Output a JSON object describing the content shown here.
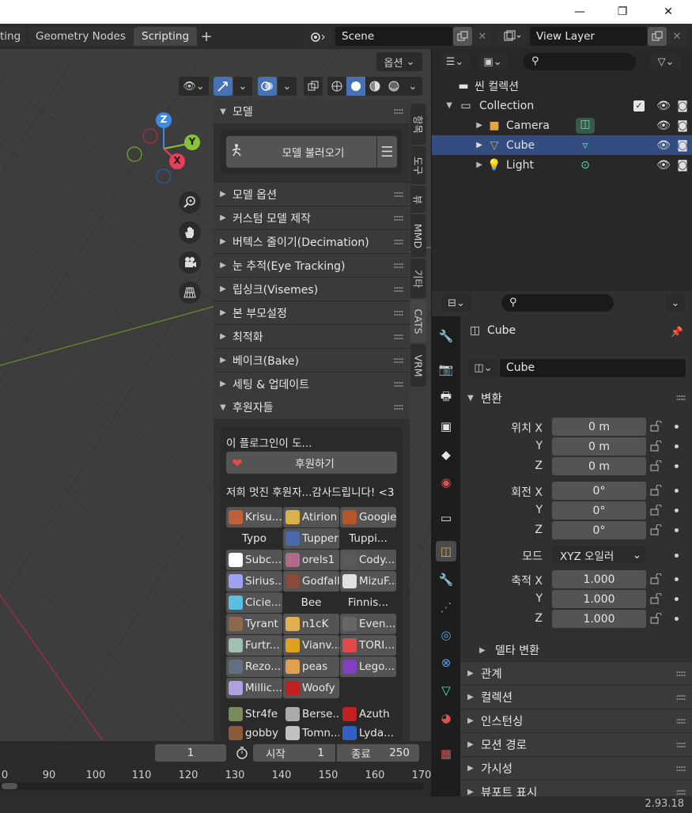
{
  "window": {
    "minimize": "—",
    "maximize": "❐",
    "close": "✕"
  },
  "workspace_tabs": [
    {
      "label": "ting",
      "active": false
    },
    {
      "label": "Geometry Nodes",
      "active": false
    },
    {
      "label": "Scripting",
      "active": true
    }
  ],
  "scene": {
    "label": "Scene",
    "view_layer": "View Layer"
  },
  "viewport": {
    "options_label": "옵션",
    "gizmo_axes": [
      "Z",
      "Y",
      "X"
    ]
  },
  "cats": {
    "model_header": "모델",
    "import_button": "모델 불러오기",
    "sections": [
      "모델 옵션",
      "커스텀 모델 제작",
      "버텍스 줄이기(Decimation)",
      "눈 추적(Eye Tracking)",
      "립싱크(Visemes)",
      "본 부모설정",
      "최적화",
      "베이크(Bake)",
      "세팅 & 업데이트"
    ],
    "supporters_header": "후원자들",
    "plugin_text": "이 플로그인이 도...",
    "donate_button": "후원하기",
    "thanks_text": "저희 멋진 후원자...감사드립니다! <3",
    "supporters": [
      [
        "Krisu...",
        "Atirion",
        "Googie"
      ],
      [
        "Typo",
        "Tupper",
        "Tuppi..."
      ],
      [
        "Subc...",
        "orels1",
        "Cody..."
      ],
      [
        "Sirius...",
        "Godfall",
        "MizuF..."
      ],
      [
        "Cicie...",
        "Bee",
        "Finnis..."
      ],
      [
        "Tyrant",
        "n1cK",
        "Even..."
      ],
      [
        "Furtr...",
        "Vianv...",
        "TORI..."
      ],
      [
        "Rezo...",
        "peas",
        "Lego..."
      ],
      [
        "Millic...",
        "Woofy",
        ""
      ],
      [
        "Str4fe",
        "Berse...",
        "Azuth"
      ],
      [
        "gobby",
        "Tomn...",
        "Lyda..."
      ]
    ],
    "vertical_tabs": [
      "항목",
      "도구",
      "뷰",
      "MMD",
      "기타",
      "CATS",
      "VRM"
    ]
  },
  "timeline": {
    "current_frame": "1",
    "start_label": "시작",
    "start": "1",
    "end_label": "종료",
    "end": "250",
    "ticks": [
      "0",
      "90",
      "100",
      "110",
      "120",
      "130",
      "140",
      "150",
      "160",
      "170"
    ]
  },
  "outliner": {
    "scene_collection": "씬 컬렉션",
    "items": [
      {
        "name": "Collection",
        "level": 1
      },
      {
        "name": "Camera",
        "level": 2
      },
      {
        "name": "Cube",
        "level": 2,
        "selected": true
      },
      {
        "name": "Light",
        "level": 2
      }
    ]
  },
  "properties": {
    "object_name": "Cube",
    "object_field": "Cube",
    "transform_header": "변환",
    "location_label": "위치",
    "rotation_label": "회전",
    "mode_label": "모드",
    "scale_label": "축적",
    "axis_x": "X",
    "axis_y": "Y",
    "axis_z": "Z",
    "location": [
      "0 m",
      "0 m",
      "0 m"
    ],
    "rotation": [
      "0°",
      "0°",
      "0°"
    ],
    "mode_value": "XYZ 오일러",
    "scale": [
      "1.000",
      "1.000",
      "1.000"
    ],
    "delta_transform": "델타 변환",
    "sections": [
      "관계",
      "컬렉션",
      "인스턴싱",
      "모션 경로",
      "가시성",
      "뷰포트 표시"
    ]
  },
  "status": {
    "version": "2.93.18"
  },
  "colors": {
    "accent_blue": "#4772b3",
    "selected_row": "#334d80",
    "axis_x": "#e93f5a",
    "axis_y": "#86c437",
    "axis_z": "#3d8ae5"
  }
}
